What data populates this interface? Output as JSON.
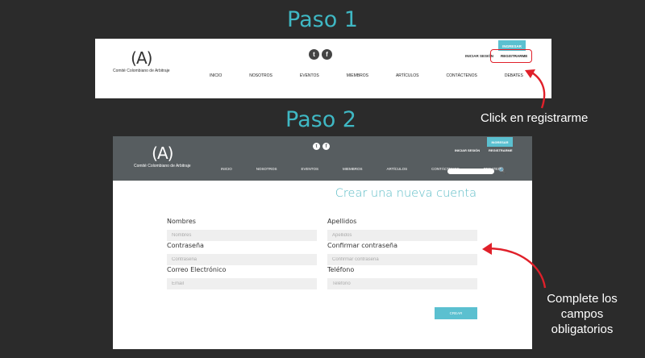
{
  "step1": {
    "title": "Paso 1",
    "logo_text": "Comité Colombiano de Arbitraje",
    "logo_mark": "(A)",
    "social": [
      "t",
      "f"
    ],
    "nav": [
      "INICIO",
      "NOSOTROS",
      "EVENTOS",
      "MIEMBROS",
      "ARTÍCULOS",
      "CONTÁCTENOS",
      "DEBATES"
    ],
    "login": "INICIAR SESIÓN",
    "ingresar": "INGRESAR",
    "register": "REGISTRARME"
  },
  "callout1": "Click en registrarme",
  "step2": {
    "title": "Paso 2",
    "logo_text": "Comité Colombiano de Arbitraje",
    "logo_mark": "(A)",
    "social": [
      "t",
      "f"
    ],
    "nav": [
      "INICIO",
      "NOSOTROS",
      "EVENTOS",
      "MIEMBROS",
      "ARTÍCULOS",
      "CONTÁCTENOS",
      "DEBATES"
    ],
    "login": "INICIAR SESIÓN",
    "ingresar": "INGRESAR",
    "register": "REGISTRARME",
    "search_icon": "🔍",
    "form_title": "Crear una nueva cuenta",
    "fields": {
      "nombres": {
        "label": "Nombres",
        "placeholder": "Nombres"
      },
      "apellidos": {
        "label": "Apellidos",
        "placeholder": "Apellidos"
      },
      "contrasena": {
        "label": "Contraseña",
        "placeholder": "Contraseña"
      },
      "confirmar": {
        "label": "Confirmar contraseña",
        "placeholder": "Confirmar contraseña"
      },
      "correo": {
        "label": "Correo Electrónico",
        "placeholder": "Email"
      },
      "telefono": {
        "label": "Teléfono",
        "placeholder": "Teléfono"
      }
    },
    "submit": "CREAR"
  },
  "callout2": "Complete los campos obligatorios",
  "colors": {
    "background": "#2b2b2b",
    "accent": "#3fb8c4",
    "header": "#575d60",
    "button": "#5bc0d0",
    "annotation": "#e0202a"
  }
}
